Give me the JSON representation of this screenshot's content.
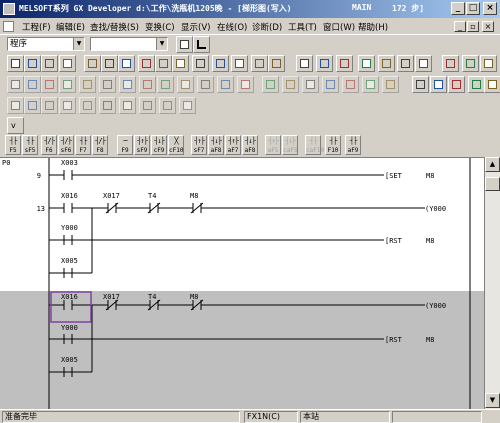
{
  "titlebar": {
    "title": "MELSOFT系列 GX Developer d:\\工作\\洗瓶机1205晚 - [梯形图(写入)",
    "program": "MAIN",
    "steps": "172 步]"
  },
  "menu": {
    "items": [
      "工程(F)",
      "编辑(E)",
      "查找/替换(S)",
      "变换(C)",
      "显示(V)",
      "在线(O)",
      "诊断(D)",
      "工具(T)",
      "窗口(W)",
      "帮助(H)"
    ]
  },
  "data_type_combo": {
    "value": "程序"
  },
  "fkeys": [
    {
      "sym": "┤├",
      "label": "F5"
    },
    {
      "sym": "┤├",
      "label": "sF5"
    },
    {
      "sym": "┤/├",
      "label": "F6"
    },
    {
      "sym": "┤/├",
      "label": "sF6"
    },
    {
      "sym": "┤├",
      "label": "F7"
    },
    {
      "sym": "┤/├",
      "label": "F8"
    },
    {
      "sym": "─",
      "label": "F9"
    },
    {
      "sym": "┤↑├",
      "label": "sF9"
    },
    {
      "sym": "┤↓├",
      "label": "cF9"
    },
    {
      "sym": "╳",
      "label": "cF10"
    },
    {
      "sym": "┤↑├",
      "label": "sF7"
    },
    {
      "sym": "┤↓├",
      "label": "aF8"
    },
    {
      "sym": "┤↑├",
      "label": "aF7"
    },
    {
      "sym": "┤↓├",
      "label": "aF8"
    },
    {
      "sym": "┤↑├",
      "label": "aF5"
    },
    {
      "sym": "┤↓├",
      "label": "caF5"
    },
    {
      "sym": "┤├",
      "label": "caF10"
    },
    {
      "sym": "┤├",
      "label": "F10"
    },
    {
      "sym": "┤├",
      "label": "aF9"
    }
  ],
  "ladder": {
    "marker": "P0",
    "rungs": [
      {
        "step": "9",
        "contacts": [
          "X003"
        ],
        "coil": "SET",
        "operand": "M8"
      },
      {
        "step": "13",
        "contacts": [
          "X016",
          "X017",
          "T4",
          "M8"
        ],
        "coil": "Y000",
        "branches": [
          "Y000",
          "X005"
        ],
        "coil2": "RST",
        "operand2": "M8"
      },
      {
        "step": "",
        "contacts": [
          "X016",
          "X017",
          "T4",
          "M8"
        ],
        "coil": "Y000",
        "branches": [
          "Y000",
          "X005"
        ],
        "coil2": "RST",
        "operand2": "M8"
      }
    ],
    "row_labels": {
      "set": "[SET",
      "rst": "[RST",
      "y000": "(Y000",
      "m8": "M8"
    }
  },
  "status": {
    "ready": "准备完毕",
    "plc": "FX1N(C)",
    "location": "本站"
  }
}
